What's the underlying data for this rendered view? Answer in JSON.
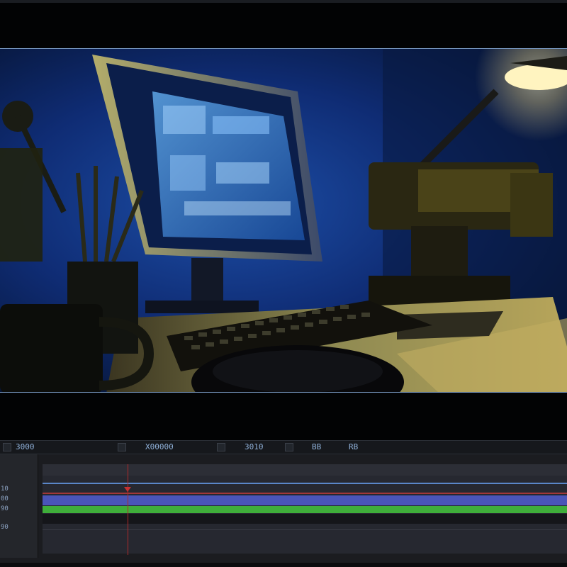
{
  "viewer": {
    "scene": "desk-scene"
  },
  "toolbar": {
    "timecode_left": "3000",
    "timecode_center": "X00000",
    "timecode_right": "3010",
    "label_1": "BB",
    "label_2": "RB"
  },
  "track_headers": {
    "row_1": "10",
    "row_2": "00",
    "row_3": "90",
    "row_4": "90"
  },
  "colors": {
    "accent_blue": "#7a9cc6",
    "video_track": "#4a55b8",
    "audio_track": "#3fae3a",
    "playhead": "#c63131"
  },
  "icons": {
    "toolbar_left": "square-icon",
    "toolbar_mid": "square-icon"
  }
}
